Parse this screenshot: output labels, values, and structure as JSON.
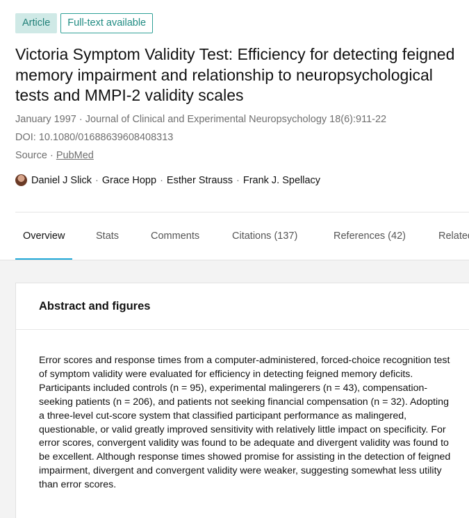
{
  "badges": {
    "type": "Article",
    "availability": "Full-text available"
  },
  "publication": {
    "title": "Victoria Symptom Validity Test: Efficiency for detecting feigned memory impairment and relationship to neuropsychological tests and MMPI-2 validity scales",
    "date_journal": "January 1997 · Journal of Clinical and Experimental Neuropsychology 18(6):911-22",
    "doi": "DOI: 10.1080/01688639608408313",
    "source_prefix": "Source · ",
    "source_link": "PubMed"
  },
  "authors": [
    "Daniel J Slick",
    "Grace Hopp",
    "Esther Strauss",
    "Frank J. Spellacy"
  ],
  "author_separator": "·",
  "tabs": [
    {
      "label": "Overview",
      "active": true
    },
    {
      "label": "Stats"
    },
    {
      "label": "Comments"
    },
    {
      "label": "Citations (137)"
    },
    {
      "label": "References (42)"
    },
    {
      "label": "Related research"
    }
  ],
  "abstract_card": {
    "title": "Abstract and figures",
    "text": "Error scores and response times from a computer-administered, forced-choice recognition test of symptom validity were evaluated for efficiency in detecting feigned memory deficits. Participants included controls (n = 95), experimental malingerers (n = 43), compensation-seeking patients (n = 206), and patients not seeking financial compensation (n = 32). Adopting a three-level cut-score system that classified participant performance as malingered, questionable, or valid greatly improved sensitivity with relatively little impact on specificity. For error scores, convergent validity was found to be adequate and divergent validity was found to be excellent. Although response times showed promise for assisting in the detection of feigned impairment, divergent and convergent validity were weaker, suggesting somewhat less utility than error scores."
  },
  "colors": {
    "badge_solid_bg": "#cfe9e6",
    "badge_text": "#1f7f77",
    "tab_active_underline": "#1ea8d8",
    "page_bg": "#f3f3f3"
  }
}
